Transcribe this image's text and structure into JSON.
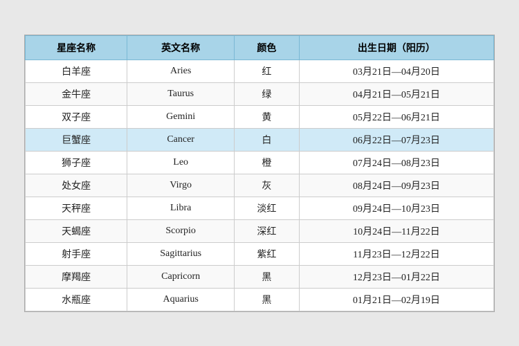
{
  "table": {
    "headers": [
      "星座名称",
      "英文名称",
      "颜色",
      "出生日期（阳历）"
    ],
    "rows": [
      {
        "chinese": "白羊座",
        "english": "Aries",
        "color": "红",
        "dates": "03月21日—04月20日",
        "highlight": false
      },
      {
        "chinese": "金牛座",
        "english": "Taurus",
        "color": "绿",
        "dates": "04月21日—05月21日",
        "highlight": false
      },
      {
        "chinese": "双子座",
        "english": "Gemini",
        "color": "黄",
        "dates": "05月22日—06月21日",
        "highlight": false
      },
      {
        "chinese": "巨蟹座",
        "english": "Cancer",
        "color": "白",
        "dates": "06月22日—07月23日",
        "highlight": true
      },
      {
        "chinese": "狮子座",
        "english": "Leo",
        "color": "橙",
        "dates": "07月24日—08月23日",
        "highlight": false
      },
      {
        "chinese": "处女座",
        "english": "Virgo",
        "color": "灰",
        "dates": "08月24日—09月23日",
        "highlight": false
      },
      {
        "chinese": "天秤座",
        "english": "Libra",
        "color": "淡红",
        "dates": "09月24日—10月23日",
        "highlight": false
      },
      {
        "chinese": "天蝎座",
        "english": "Scorpio",
        "color": "深红",
        "dates": "10月24日—11月22日",
        "highlight": false
      },
      {
        "chinese": "射手座",
        "english": "Sagittarius",
        "color": "紫红",
        "dates": "11月23日—12月22日",
        "highlight": false
      },
      {
        "chinese": "摩羯座",
        "english": "Capricorn",
        "color": "黑",
        "dates": "12月23日—01月22日",
        "highlight": false
      },
      {
        "chinese": "水瓶座",
        "english": "Aquarius",
        "color": "黑",
        "dates": "01月21日—02月19日",
        "highlight": false
      }
    ]
  }
}
